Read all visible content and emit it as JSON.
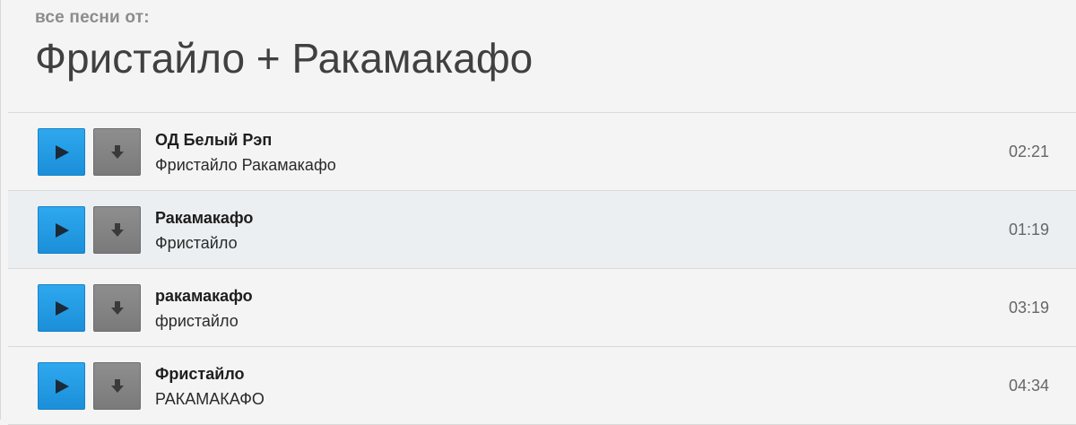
{
  "header": {
    "subtitle": "все песни от:",
    "title": "Фристайло + Ракамакафо"
  },
  "icons": {
    "play": "play-icon",
    "download": "download-icon"
  },
  "colors": {
    "play_button": "#1b8fd9",
    "download_button": "#808080"
  },
  "tracks": [
    {
      "title": "ОД Белый Рэп",
      "artist": "Фристайло Ракамакафо",
      "duration": "02:21"
    },
    {
      "title": "Ракамакафо",
      "artist": "Фристайло",
      "duration": "01:19"
    },
    {
      "title": "ракамакафо",
      "artist": "фристайло",
      "duration": "03:19"
    },
    {
      "title": "Фристайло",
      "artist": "РАКАМАКАФО",
      "duration": "04:34"
    }
  ]
}
